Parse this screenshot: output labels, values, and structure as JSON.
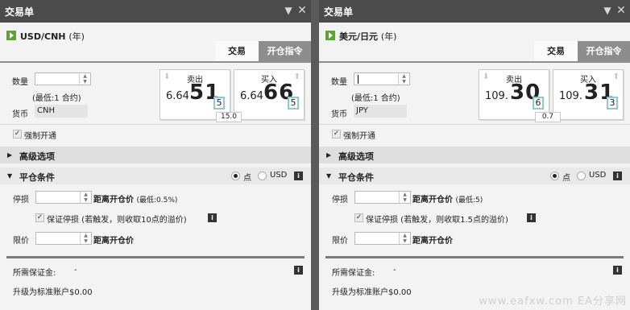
{
  "panels": [
    {
      "title": "交易单",
      "instrument": "USD/CNH",
      "period": "(年)",
      "tabs": {
        "trade": "交易",
        "order": "开仓指令"
      },
      "quantity_label": "数量",
      "quantity_hint": "(最低:1 合约)",
      "currency_label": "货币",
      "currency": "CNH",
      "sell": {
        "label": "卖出",
        "pre": "6.64",
        "big": "51",
        "pip": "5"
      },
      "buy": {
        "label": "买入",
        "pre": "6.64",
        "big": "66",
        "pip": "5"
      },
      "spread": "15.0",
      "force_open": "强制开通",
      "advanced": "高级选项",
      "close_conditions": "平仓条件",
      "radio_points": "点",
      "radio_usd": "USD",
      "stop_loss_label": "停损",
      "distance_label": "距离开仓价",
      "distance_min": "(最低:0.5%)",
      "guaranteed_stop": "保证停损 (若触发，则收取10点的溢价)",
      "limit_label": "限价",
      "distance_label_2": "距离开仓价",
      "margin_label": "所需保证金:",
      "margin_value": "-",
      "upgrade": "升级为标准账户$0.00",
      "watermark": ""
    },
    {
      "title": "交易单",
      "instrument": "美元/日元",
      "period": "(年)",
      "tabs": {
        "trade": "交易",
        "order": "开仓指令"
      },
      "quantity_label": "数量",
      "quantity_hint": "(最低:1 合约)",
      "currency_label": "货币",
      "currency": "JPY",
      "sell": {
        "label": "卖出",
        "pre": "109.",
        "big": "30",
        "pip": "6"
      },
      "buy": {
        "label": "买入",
        "pre": "109.",
        "big": "31",
        "pip": "3"
      },
      "spread": "0.7",
      "force_open": "强制开通",
      "advanced": "高级选项",
      "close_conditions": "平仓条件",
      "radio_points": "点",
      "radio_usd": "USD",
      "stop_loss_label": "停损",
      "distance_label": "距离开仓价",
      "distance_min": "(最低:5)",
      "guaranteed_stop": "保证停损 (若触发，则收取1.5点的溢价)",
      "limit_label": "限价",
      "distance_label_2": "距离开仓价",
      "margin_label": "所需保证金:",
      "margin_value": "-",
      "upgrade": "升级为标准账户$0.00",
      "watermark": "www.eafxw.com EA分享网"
    }
  ],
  "icons": {
    "minimize": "chevron-down-icon",
    "close": "close-icon",
    "play": "play-icon",
    "info": "info-icon"
  },
  "colors": {
    "accent_green": "#5aa531",
    "pip_border": "#8ec7d7",
    "titlebar": "#4b4b4b"
  }
}
